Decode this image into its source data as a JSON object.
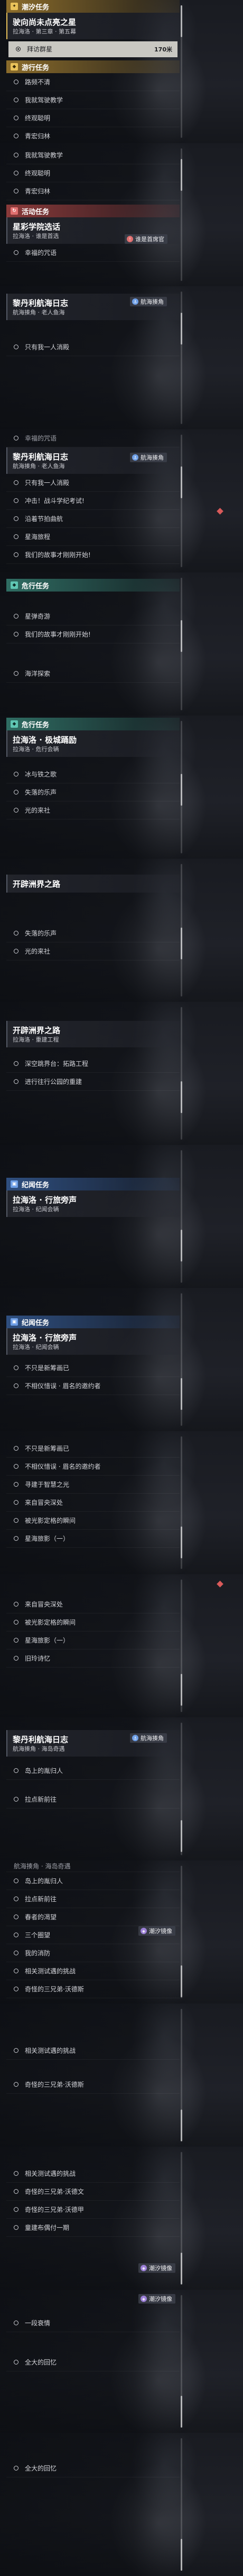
{
  "frame1": {
    "tide_header": "潮汐任务",
    "tide_quest_title": "驶向尚未点亮之星",
    "tide_quest_sub": "拉海洛 · 第三章 · 第五幕",
    "row_museum": "拜访群星",
    "row_museum_dist": "170米",
    "journey_header": "游行任务",
    "rows": [
      "路频不清",
      "我就驾驶教学",
      "终观聪明",
      "青宏归林"
    ]
  },
  "frame2": {
    "rows": [
      "我就驾驶教学",
      "终观聪明",
      "青宏归林"
    ],
    "event_header": "活动任务",
    "event_title": "星彩学院选话",
    "event_sub": "拉海洛 · 谁是首选",
    "event_badge": "谁是首席官",
    "event_row": "幸福的咒语"
  },
  "frame3": {
    "quest_title": "黎丹利航海日志",
    "quest_sub": "航海揍角 · 老人鱼海",
    "badge": "航海揍角",
    "rows": [
      "只有我一人消殿"
    ]
  },
  "frame4": {
    "top_row": "幸福的咒语",
    "quest_title": "黎丹利航海日志",
    "quest_sub": "航海揍角 · 老人鱼海",
    "badge": "航海揍角",
    "rows": [
      "只有我一人消殿",
      "冲击！战斗学纪考试!",
      "沿着节拍曲航",
      "星海旅程",
      "我们的故事才刚刚开始!"
    ]
  },
  "frame5": {
    "danger_header": "危行任务",
    "rows": [
      "星弹奇游",
      "我们的故事才刚刚开始!",
      "海洋探索"
    ]
  },
  "frame6": {
    "header": "危行任务",
    "quest_title": "拉海洛 · 极城踊励",
    "quest_sub": "拉海洛 · 危行会辆",
    "rows": [
      "冰与铁之歌",
      "失落的乐声",
      "光的来社"
    ]
  },
  "frame7": {
    "quest_title": "开辟洲界之路",
    "rows": [
      "失落的乐声",
      "光的来社"
    ]
  },
  "frame8": {
    "quest_title": "开辟洲界之路",
    "quest_sub": "拉海洛 · 重建工程",
    "rows": [
      "深空跳界台：拓路工程",
      "进行往行公园的重建"
    ]
  },
  "frame9": {
    "header": "纪闻任务",
    "quest_title": "拉海洛 · 行旅旁声",
    "quest_sub": "拉海洛 · 纪闻会辆"
  },
  "frame10": {
    "header": "纪闻任务",
    "quest_title": "拉海洛 · 行旅旁声",
    "quest_sub": "拉海洛 · 纪闻会辆",
    "rows": [
      "不只是新筹画已",
      "不相仪惜误 · 眉名的邀约者"
    ]
  },
  "frame11": {
    "rows": [
      "不只是新筹画已",
      "不相仪惜误 · 眉名的邀约者",
      "寻建于智慧之光",
      "来自冒央深处",
      "被光影定格的瞬间",
      "星海旅影（一）"
    ]
  },
  "frame12": {
    "rows": [
      "来自冒央深处",
      "被光影定格的瞬间",
      "星海旅影（一）",
      "旧玲诗忆"
    ]
  },
  "frame13": {
    "quest_title": "黎丹利航海日志",
    "quest_sub": "航海揍角 · 海岛奇遇",
    "badge": "航海揍角",
    "rows": [
      "岛上的胤归人",
      "拉点新前往"
    ]
  },
  "frame14": {
    "top_row": "航海揍角 · 海岛奇遇",
    "rows": [
      "岛上的胤归人",
      "拉点新前往",
      "春者的渴望",
      "三个圈望",
      "我的消防",
      "相关测试遇的挑战",
      "奇怪的三兄弟·沃德斯"
    ],
    "badge": "潮汐镜像"
  },
  "frame15": {
    "rows": [
      "相关测试遇的挑战",
      "奇怪的三兄弟·沃德斯"
    ]
  },
  "frame16": {
    "rows": [
      "相关测试遇的挑战",
      "奇怪的三兄弟·沃德文",
      "奇怪的三兄弟·沃德甲",
      "童建布偶付一期"
    ],
    "badge": "潮汐镜像"
  },
  "frame17": {
    "rows": [
      "一段衰情",
      "全大的回忆"
    ],
    "badge": "潮汐镜像"
  },
  "frame18": {
    "rows": [
      "全大的回忆"
    ]
  },
  "colors": {
    "tide_yellow": "#e9c25a",
    "event_red": "#e07070",
    "danger_green": "#5fc6b3",
    "lore_blue": "#6d9ee6",
    "highlight": "#c9c8c2"
  },
  "icons": [
    "tide-icon",
    "journey-icon",
    "event-icon",
    "danger-icon",
    "lore-icon",
    "ship-icon",
    "mirror-icon",
    "location-diamond-icon"
  ]
}
